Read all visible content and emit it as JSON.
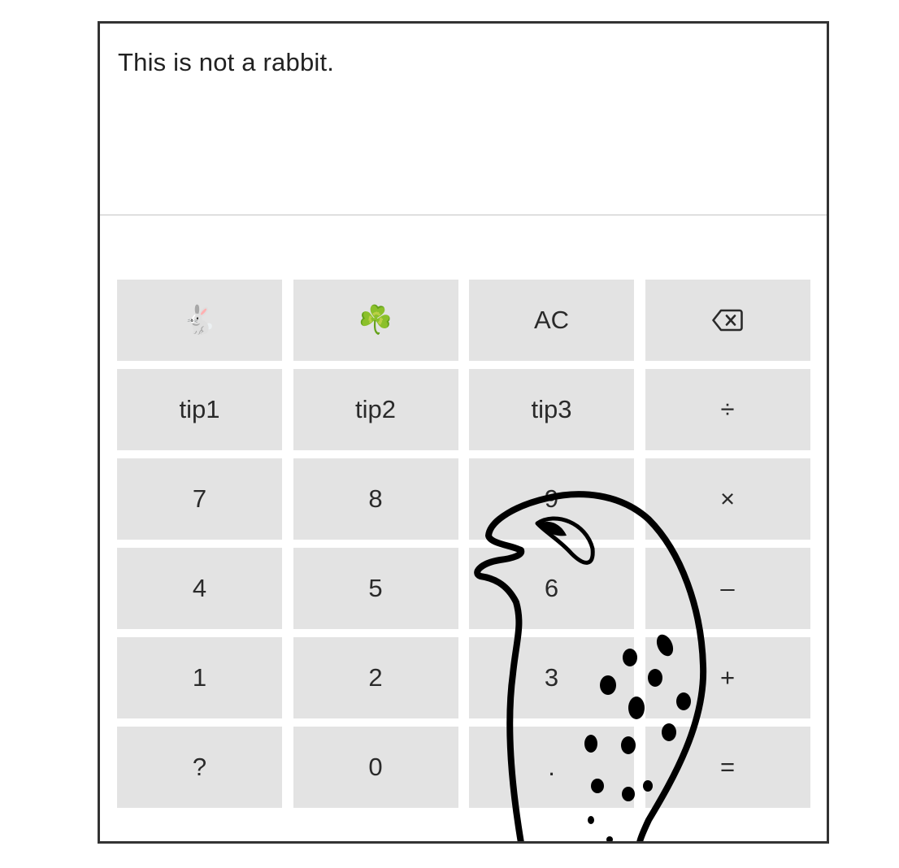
{
  "display": {
    "text": "This is not a rabbit."
  },
  "keys": [
    {
      "name": "rabbit-key",
      "label": "🐇",
      "icon": "rabbit-icon"
    },
    {
      "name": "shamrock-key",
      "label": "☘️",
      "icon": "shamrock-icon"
    },
    {
      "name": "all-clear-button",
      "label": "AC"
    },
    {
      "name": "backspace-button",
      "label": "",
      "icon": "backspace-icon"
    },
    {
      "name": "tip1-button",
      "label": "tip1"
    },
    {
      "name": "tip2-button",
      "label": "tip2"
    },
    {
      "name": "tip3-button",
      "label": "tip3"
    },
    {
      "name": "divide-button",
      "label": "÷"
    },
    {
      "name": "digit-7-button",
      "label": "7"
    },
    {
      "name": "digit-8-button",
      "label": "8"
    },
    {
      "name": "digit-9-button",
      "label": "9"
    },
    {
      "name": "multiply-button",
      "label": "×"
    },
    {
      "name": "digit-4-button",
      "label": "4"
    },
    {
      "name": "digit-5-button",
      "label": "5"
    },
    {
      "name": "digit-6-button",
      "label": "6"
    },
    {
      "name": "subtract-button",
      "label": "–"
    },
    {
      "name": "digit-1-button",
      "label": "1"
    },
    {
      "name": "digit-2-button",
      "label": "2"
    },
    {
      "name": "digit-3-button",
      "label": "3"
    },
    {
      "name": "add-button",
      "label": "+"
    },
    {
      "name": "question-button",
      "label": "?"
    },
    {
      "name": "digit-0-button",
      "label": "0"
    },
    {
      "name": "decimal-button",
      "label": "."
    },
    {
      "name": "equals-button",
      "label": "="
    }
  ]
}
